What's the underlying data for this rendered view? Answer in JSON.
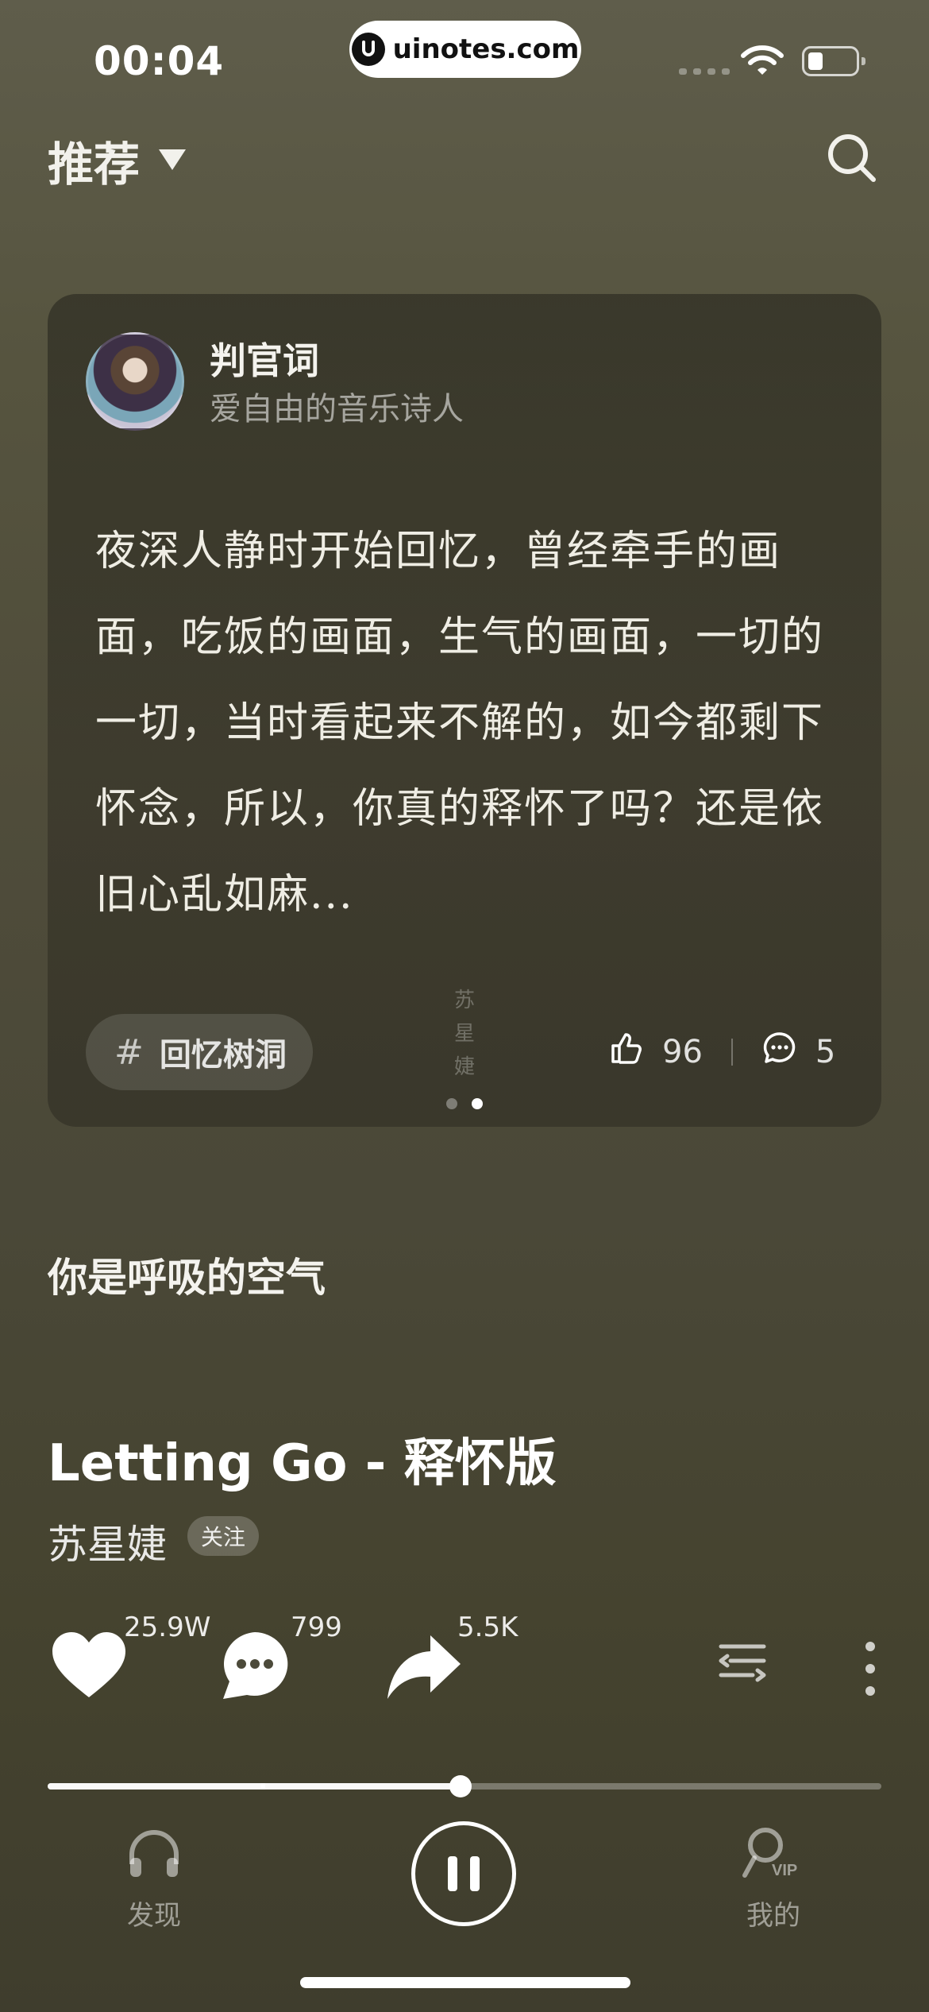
{
  "status_bar": {
    "time": "00:04",
    "site_badge": "uinotes.com"
  },
  "header": {
    "tab_label": "推荐"
  },
  "post": {
    "author_name": "判官词",
    "author_subtitle": "爱自由的音乐诗人",
    "text": "夜深人静时开始回忆，曾经牵手的画面，吃饭的画面，生气的画面，一切的一切，当时看起来不解的，如今都剩下怀念，所以，你真的释怀了吗？还是依旧心乱如麻...",
    "topic": "回忆树洞",
    "watermark_lines": [
      "苏",
      "星",
      "婕"
    ],
    "likes": "96",
    "comments": "5",
    "page_dots": {
      "count": 2,
      "active_index": 1
    }
  },
  "lyric_line": "你是呼吸的空气",
  "song": {
    "title": "Letting Go - 释怀版",
    "artist": "苏星婕",
    "follow_label": "关注"
  },
  "actions": {
    "favorite_count": "25.9W",
    "comment_count": "799",
    "share_count": "5.5K"
  },
  "playback": {
    "progress": 0.495,
    "buffered": 0.255
  },
  "bottom_nav": {
    "discover_label": "发现",
    "mine_label": "我的"
  },
  "colors": {
    "background": "#4f4c3a",
    "card": "#2f2e24",
    "accent": "#ffffff"
  }
}
